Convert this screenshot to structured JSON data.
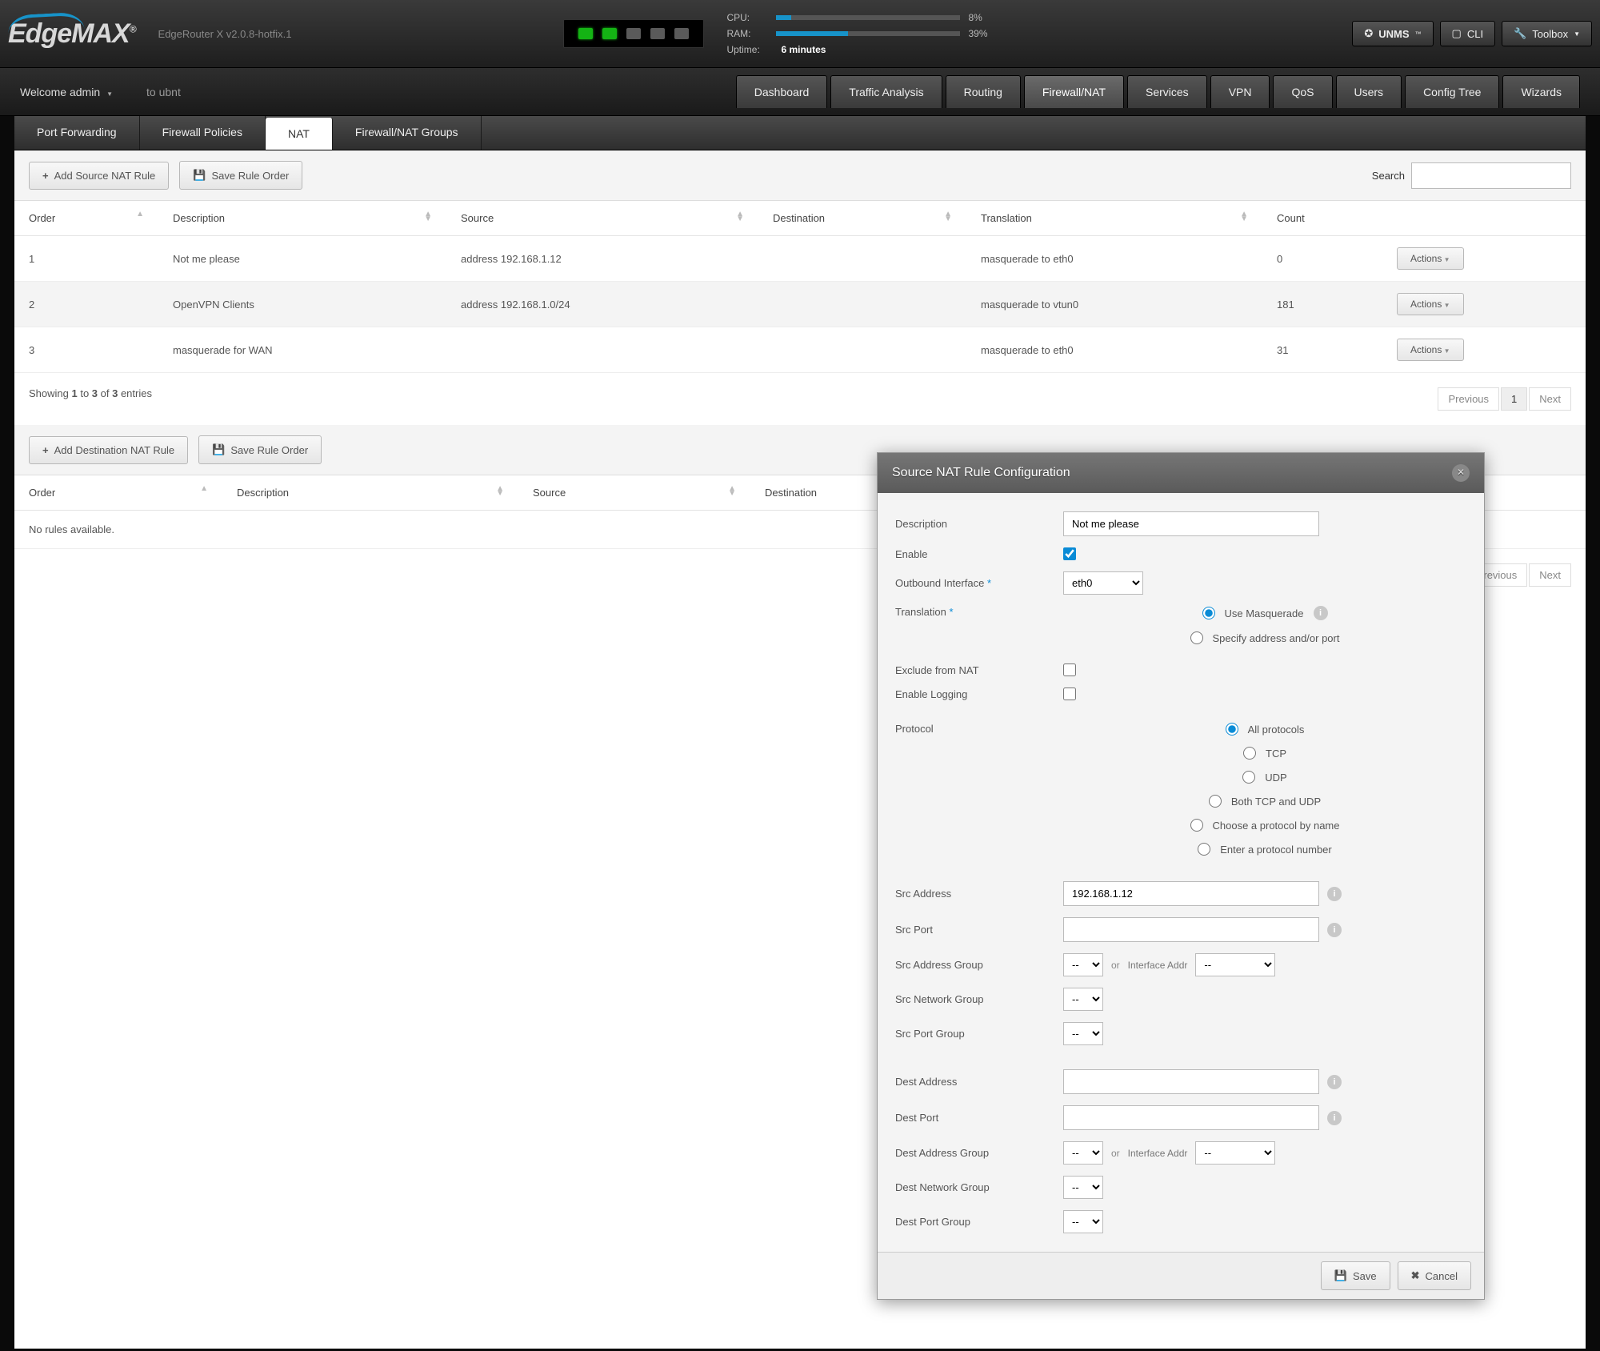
{
  "brand": "EdgeMAX",
  "model": "EdgeRouter X v2.0.8-hotfix.1",
  "stats": {
    "cpu_label": "CPU:",
    "cpu_val": "8%",
    "cpu_pct": 8,
    "ram_label": "RAM:",
    "ram_val": "39%",
    "ram_pct": 39,
    "uptime_label": "Uptime:",
    "uptime_val": "6 minutes"
  },
  "top_buttons": {
    "unms": "UNMS",
    "cli": "CLI",
    "toolbox": "Toolbox"
  },
  "welcome": "Welcome admin",
  "toubnt": "to ubnt",
  "main_tabs": [
    "Dashboard",
    "Traffic Analysis",
    "Routing",
    "Firewall/NAT",
    "Services",
    "VPN",
    "QoS",
    "Users",
    "Config Tree",
    "Wizards"
  ],
  "main_tab_active": 3,
  "sub_tabs": [
    "Port Forwarding",
    "Firewall Policies",
    "NAT",
    "Firewall/NAT Groups"
  ],
  "sub_tab_active": 2,
  "snat_toolbar": {
    "add": "Add Source NAT Rule",
    "save": "Save Rule Order",
    "search": "Search"
  },
  "snat_cols": [
    "Order",
    "Description",
    "Source",
    "Destination",
    "Translation",
    "Count",
    ""
  ],
  "snat_rows": [
    {
      "order": "1",
      "desc": "Not me please",
      "src": "address 192.168.1.12",
      "dst": "",
      "trans": "masquerade to eth0",
      "count": "0"
    },
    {
      "order": "2",
      "desc": "OpenVPN Clients",
      "src": "address 192.168.1.0/24",
      "dst": "",
      "trans": "masquerade to vtun0",
      "count": "181"
    },
    {
      "order": "3",
      "desc": "masquerade for WAN",
      "src": "",
      "dst": "",
      "trans": "masquerade to eth0",
      "count": "31"
    }
  ],
  "actions_label": "Actions",
  "showing_head": "Showing ",
  "showing_14": "1",
  "showing_to": " to ",
  "showing_3a": "3",
  "showing_of": " of ",
  "showing_3b": "3",
  "showing_tail": " entries",
  "pager": {
    "prev": "Previous",
    "one": "1",
    "next": "Next"
  },
  "dnat_toolbar": {
    "add": "Add Destination NAT Rule",
    "save": "Save Rule Order"
  },
  "dnat_cols": [
    "Order",
    "Description",
    "Source",
    "Destination"
  ],
  "norules": "No rules available.",
  "modal": {
    "title": "Source NAT Rule Configuration",
    "labels": {
      "desc": "Description",
      "enable": "Enable",
      "outif": "Outbound Interface",
      "trans": "Translation",
      "exclude": "Exclude from NAT",
      "log": "Enable Logging",
      "proto": "Protocol",
      "srcaddr": "Src Address",
      "srcport": "Src Port",
      "srcaddrgrp": "Src Address Group",
      "srcnetgrp": "Src Network Group",
      "srcportgrp": "Src Port Group",
      "dstaddr": "Dest Address",
      "dstport": "Dest Port",
      "dstaddrgrp": "Dest Address Group",
      "dstnetgrp": "Dest Network Group",
      "dstportgrp": "Dest Port Group"
    },
    "vals": {
      "desc": "Not me please",
      "outif": "eth0",
      "srcaddr": "192.168.1.12"
    },
    "trans_opts": [
      "Use Masquerade",
      "Specify address and/or port"
    ],
    "proto_opts": [
      "All protocols",
      "TCP",
      "UDP",
      "Both TCP and UDP",
      "Choose a protocol by name",
      "Enter a protocol number"
    ],
    "or": "or",
    "iface_addr": "Interface Addr",
    "dash": "--",
    "save": "Save",
    "cancel": "Cancel",
    "req": "*"
  }
}
